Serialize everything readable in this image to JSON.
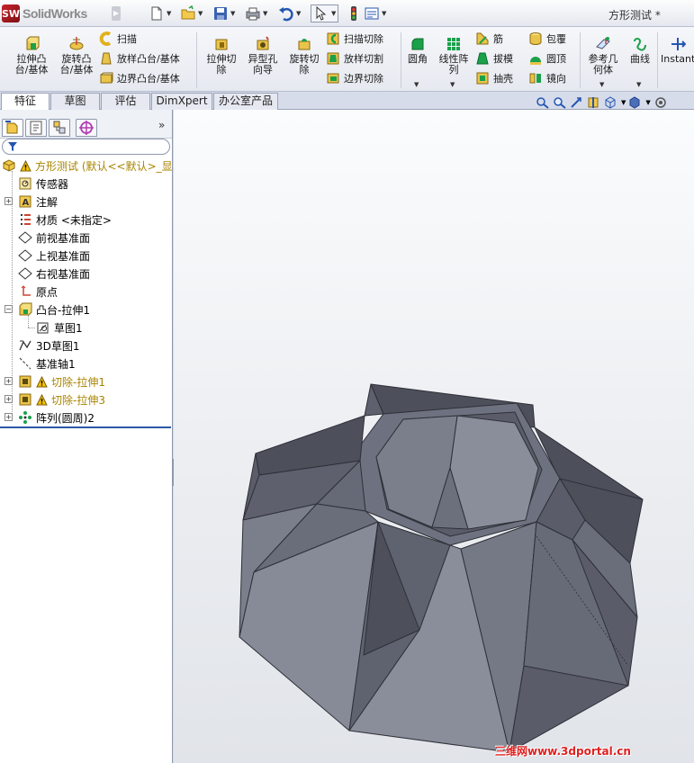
{
  "app": {
    "brand": "SolidWorks",
    "document_title": "方形测试 *"
  },
  "quick_access": {
    "new_icon": "new-document-icon",
    "open_icon": "open-folder-icon",
    "save_icon": "save-icon",
    "print_icon": "print-icon",
    "undo_icon": "undo-icon",
    "select_icon": "select-cursor-icon",
    "rebuild_icon": "traffic-light-icon",
    "options_icon": "options-icon"
  },
  "ribbon": {
    "extrude_boss": "拉伸凸\n台/基体",
    "revolve_boss": "旋转凸\n台/基体",
    "sweep": "扫描",
    "loft_boss": "放样凸台/基体",
    "boundary_boss": "边界凸台/基体",
    "extrude_cut": "拉伸切\n除",
    "hole_wizard": "异型孔\n向导",
    "revolve_cut": "旋转切\n除",
    "swept_cut": "扫描切除",
    "lofted_cut": "放样切割",
    "boundary_cut": "边界切除",
    "fillet": "圆角",
    "linear_pattern": "线性阵\n列",
    "rib": "筋",
    "draft": "拔模",
    "shell": "抽壳",
    "wrap": "包覆",
    "dome": "圆顶",
    "mirror": "镜向",
    "ref_geometry": "参考几\n何体",
    "curves": "曲线",
    "instant3d": "Instant"
  },
  "tabs": [
    {
      "label": "特征",
      "active": true
    },
    {
      "label": "草图",
      "active": false
    },
    {
      "label": "评估",
      "active": false
    },
    {
      "label": "DimXpert",
      "active": false
    },
    {
      "label": "办公室产品",
      "active": false
    }
  ],
  "feature_tree": {
    "expand_glyph": "»",
    "root": "方形测试 (默认<<默认>_显",
    "items": [
      {
        "label": "传感器",
        "icon": "sensor-icon"
      },
      {
        "label": "注解",
        "icon": "annotation-icon"
      },
      {
        "label": "材质 <未指定>",
        "icon": "material-icon"
      },
      {
        "label": "前视基准面",
        "icon": "plane-icon"
      },
      {
        "label": "上视基准面",
        "icon": "plane-icon"
      },
      {
        "label": "右视基准面",
        "icon": "plane-icon"
      },
      {
        "label": "原点",
        "icon": "origin-icon"
      },
      {
        "label": "凸台-拉伸1",
        "icon": "boss-extrude-icon"
      },
      {
        "label": "草图1",
        "icon": "sketch-icon"
      },
      {
        "label": "3D草图1",
        "icon": "3d-sketch-icon"
      },
      {
        "label": "基准轴1",
        "icon": "axis-icon"
      },
      {
        "label": "切除-拉伸1",
        "icon": "cut-extrude-icon",
        "warning": true
      },
      {
        "label": "切除-拉伸3",
        "icon": "cut-extrude-icon",
        "warning": true
      },
      {
        "label": "阵列(圆周)2",
        "icon": "circular-pattern-icon"
      }
    ]
  },
  "watermark": "三维网www.3dportal.cn",
  "colors": {
    "model_face_light": "#878b98",
    "model_face_mid": "#6e7280",
    "model_face_dark": "#4d505b",
    "accent_blue": "#2f58a8"
  }
}
